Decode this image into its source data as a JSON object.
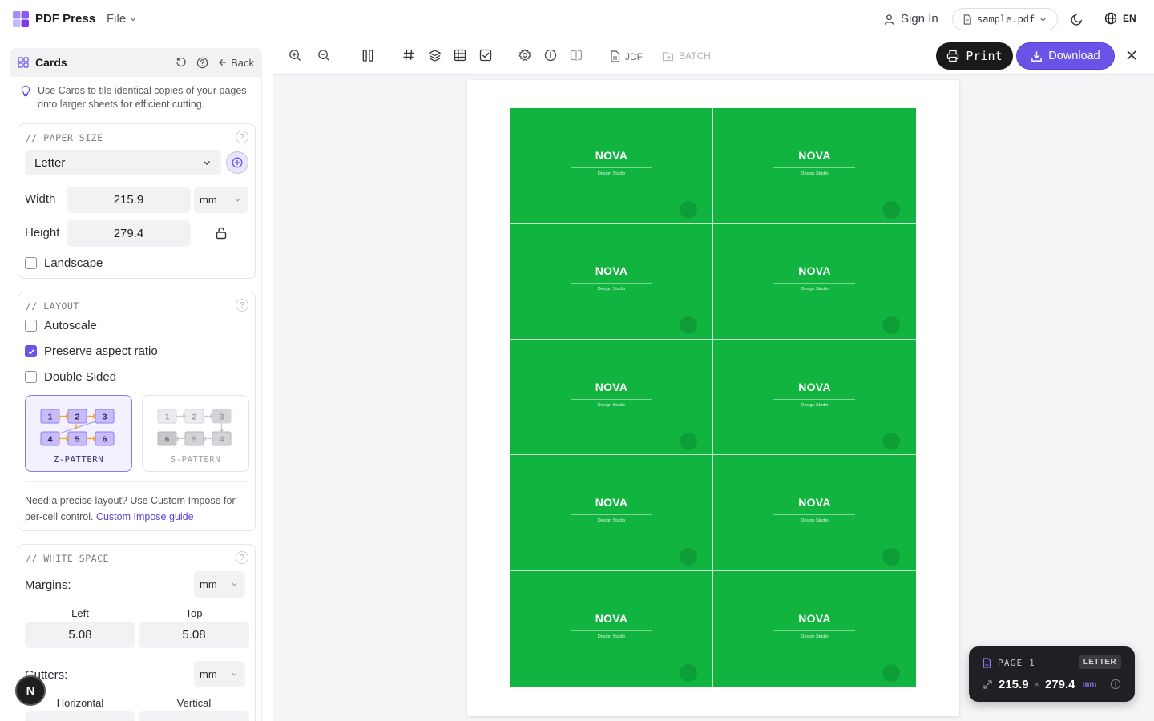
{
  "app": {
    "name": "PDF Press",
    "file_menu": "File"
  },
  "header": {
    "sign_in": "Sign In",
    "file_name": "sample.pdf",
    "language": "EN"
  },
  "sidebar": {
    "title": "Cards",
    "back_label": "Back",
    "hint": "Use Cards to tile identical copies of your pages onto larger sheets for efficient cutting.",
    "paper_size": {
      "section_title": "// PAPER SIZE",
      "selected": "Letter",
      "width_label": "Width",
      "width_value": "215.9",
      "height_label": "Height",
      "height_value": "279.4",
      "unit": "mm",
      "landscape_label": "Landscape",
      "landscape_checked": false
    },
    "layout": {
      "section_title": "// LAYOUT",
      "autoscale_label": "Autoscale",
      "autoscale_checked": false,
      "preserve_label": "Preserve aspect ratio",
      "preserve_checked": true,
      "double_sided_label": "Double Sided",
      "double_sided_checked": false,
      "patterns": [
        {
          "label": "Z-PATTERN",
          "selected": true,
          "cells": [
            "1",
            "2",
            "3",
            "4",
            "5",
            "6"
          ]
        },
        {
          "label": "S-PATTERN",
          "selected": false,
          "cells": [
            "1",
            "2",
            "3",
            "6",
            "5",
            "4"
          ]
        }
      ],
      "custom_text": "Need a precise layout? Use Custom Impose for per-cell control.",
      "custom_link": "Custom Impose guide"
    },
    "white_space": {
      "section_title": "// WHITE SPACE",
      "margins_label": "Margins:",
      "margins_unit": "mm",
      "left_label": "Left",
      "left_value": "5.08",
      "top_label": "Top",
      "top_value": "5.08",
      "gutters_label": "Gutters:",
      "gutters_unit": "mm",
      "horizontal_label": "Horizontal",
      "vertical_label": "Vertical"
    },
    "badge_letter": "N"
  },
  "toolbar": {
    "jdf_label": "JDF",
    "batch_label": "BATCH",
    "print_label": "Print",
    "download_label": "Download"
  },
  "canvas": {
    "card_title": "NOVA",
    "card_subtitle": "Design Studio",
    "card_color": "#10b43f",
    "card_count": 10
  },
  "page_panel": {
    "page_label": "PAGE 1",
    "paper_badge": "LETTER",
    "width": "215.9",
    "height": "279.4",
    "unit": "mm"
  },
  "colors": {
    "accent": "#6b53e8",
    "print_button": "#1a1a1d"
  }
}
